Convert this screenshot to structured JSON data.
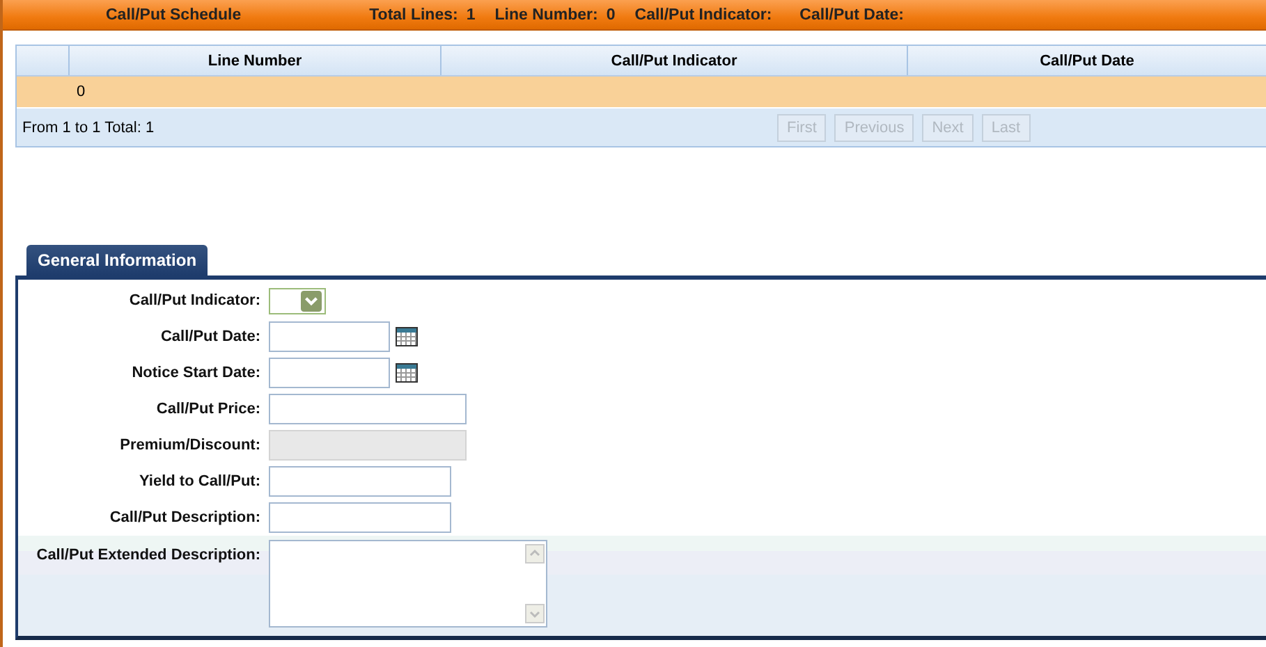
{
  "header": {
    "title": "Call/Put Schedule",
    "fields": [
      {
        "label": "Total Lines:",
        "value": "1"
      },
      {
        "label": "Line Number:",
        "value": "0"
      },
      {
        "label": "Call/Put Indicator:"
      },
      {
        "label": "Call/Put Date:"
      }
    ]
  },
  "table": {
    "columns": [
      "Line Number",
      "Call/Put Indicator",
      "Call/Put Date"
    ],
    "rows": [
      {
        "cells": [
          "0",
          "",
          ""
        ],
        "selected": true
      }
    ]
  },
  "pager": {
    "summary": "From 1 to 1 Total: 1",
    "buttons": [
      {
        "label": "First",
        "disabled": true
      },
      {
        "label": "Previous",
        "disabled": true
      },
      {
        "label": "Next",
        "disabled": true
      },
      {
        "label": "Last",
        "disabled": true
      }
    ]
  },
  "tabs": [
    {
      "label": "General Information",
      "selected": true
    }
  ],
  "form": [
    {
      "label": "Call/Put Indicator:",
      "kind": "select"
    },
    {
      "label": "Call/Put Date:",
      "kind": "date"
    },
    {
      "label": "Notice Start Date:",
      "kind": "date"
    },
    {
      "label": "Call/Put Price:",
      "kind": "wide"
    },
    {
      "label": "Premium/Discount:",
      "kind": "disabled"
    },
    {
      "label": "Yield to Call/Put:",
      "kind": "text"
    },
    {
      "label": "Call/Put Description:",
      "kind": "text"
    },
    {
      "label": "Call/Put Extended Description:",
      "kind": "textarea"
    }
  ]
}
